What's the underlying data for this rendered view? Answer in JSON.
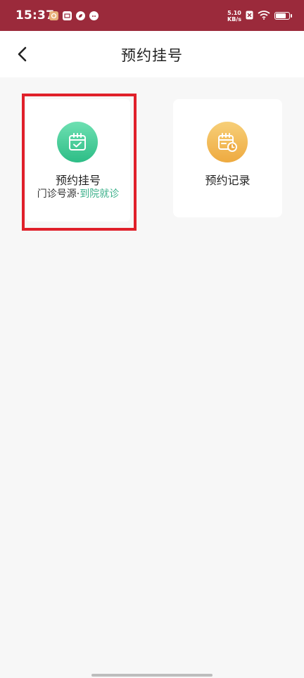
{
  "status_bar": {
    "time": "15:37",
    "net_speed_value": "5.10",
    "net_speed_unit": "KB/s",
    "background": "#9b2a3b"
  },
  "header": {
    "title": "预约挂号",
    "back_icon": "chevron-left-icon"
  },
  "cards": [
    {
      "title": "预约挂号",
      "subtitle_main": "门诊号源",
      "subtitle_sep": "·",
      "subtitle_accent": "到院就诊",
      "icon": "calendar-check-icon",
      "icon_color": "#2dbd86",
      "accent_color": "#3bb08a",
      "highlighted": true
    },
    {
      "title": "预约记录",
      "icon": "calendar-clock-icon",
      "icon_color": "#eeaa40",
      "highlighted": false
    }
  ]
}
